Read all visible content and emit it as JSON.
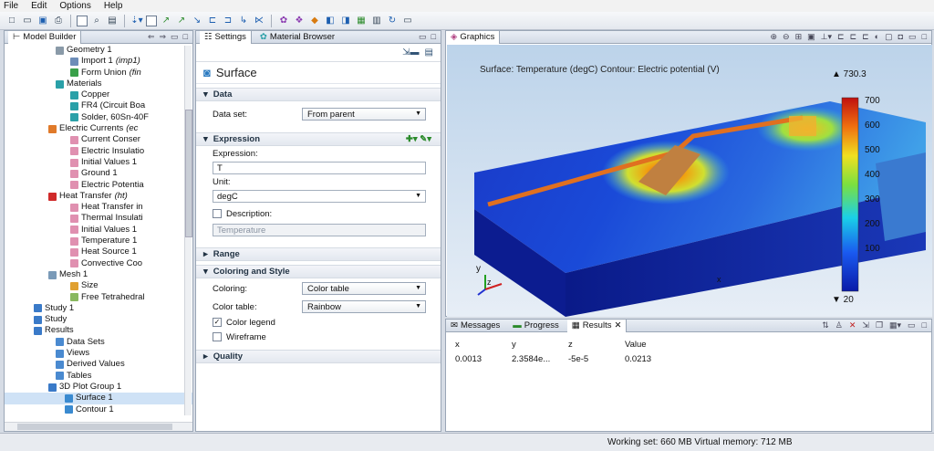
{
  "menu": [
    "File",
    "Edit",
    "Options",
    "Help"
  ],
  "builder": {
    "title": "Model Builder",
    "tree": [
      {
        "label": "Geometry 1",
        "indent": 70,
        "color": "#8a9aa8"
      },
      {
        "label": "Import 1",
        "suffix": " (imp1)",
        "indent": 86,
        "color": "#6d8db8"
      },
      {
        "label": "Form Union",
        "suffix": " (fin",
        "indent": 86,
        "color": "#39a04a"
      },
      {
        "label": "Materials",
        "indent": 70,
        "color": "#2aa0a8"
      },
      {
        "label": "Copper",
        "indent": 86,
        "color": "#2aa0a8"
      },
      {
        "label": "FR4 (Circuit Boa",
        "indent": 86,
        "color": "#2aa0a8"
      },
      {
        "label": "Solder, 60Sn-40F",
        "indent": 86,
        "color": "#2aa0a8"
      },
      {
        "label": "Electric Currents",
        "suffix": " (ec",
        "indent": 62,
        "color": "#e07a2a"
      },
      {
        "label": "Current Conser",
        "indent": 86,
        "color": "#e090b0"
      },
      {
        "label": "Electric Insulatio",
        "indent": 86,
        "color": "#e090b0"
      },
      {
        "label": "Initial Values 1",
        "indent": 86,
        "color": "#e090b0"
      },
      {
        "label": "Ground 1",
        "indent": 86,
        "color": "#e090b0"
      },
      {
        "label": "Electric Potentia",
        "indent": 86,
        "color": "#e090b0"
      },
      {
        "label": "Heat Transfer",
        "suffix": " (ht)",
        "indent": 62,
        "color": "#d02a2a"
      },
      {
        "label": "Heat Transfer in",
        "indent": 86,
        "color": "#e090b0"
      },
      {
        "label": "Thermal Insulati",
        "indent": 86,
        "color": "#e090b0"
      },
      {
        "label": "Initial Values 1",
        "indent": 86,
        "color": "#e090b0"
      },
      {
        "label": "Temperature 1",
        "indent": 86,
        "color": "#e090b0"
      },
      {
        "label": "Heat Source 1",
        "indent": 86,
        "color": "#e090b0"
      },
      {
        "label": "Convective Coo",
        "indent": 86,
        "color": "#e090b0"
      },
      {
        "label": "Mesh 1",
        "indent": 62,
        "color": "#7a9ab8"
      },
      {
        "label": "Size",
        "indent": 86,
        "color": "#e0a030"
      },
      {
        "label": "Free Tetrahedral",
        "indent": 86,
        "color": "#8ab860"
      },
      {
        "label": "Study 1",
        "indent": 46,
        "color": "#3a7ac8"
      },
      {
        "label": "Study",
        "indent": 46,
        "color": "#3a7ac8"
      },
      {
        "label": "Results",
        "indent": 46,
        "color": "#3a7ac8"
      },
      {
        "label": "Data Sets",
        "indent": 70,
        "color": "#4a8ad0"
      },
      {
        "label": "Views",
        "indent": 70,
        "color": "#4a8ad0"
      },
      {
        "label": "Derived Values",
        "indent": 70,
        "color": "#4a8ad0"
      },
      {
        "label": "Tables",
        "indent": 70,
        "color": "#4a8ad0"
      },
      {
        "label": "3D Plot Group 1",
        "indent": 62,
        "color": "#3a7ac8"
      },
      {
        "label": "Surface 1",
        "indent": 80,
        "color": "#3a8ad0",
        "selected": true
      },
      {
        "label": "Contour 1",
        "indent": 80,
        "color": "#3a8ad0"
      }
    ]
  },
  "settings": {
    "tab_settings": "Settings",
    "tab_material": "Material Browser",
    "heading": "Surface",
    "sec_data": "Data",
    "dataset_label": "Data set:",
    "dataset_value": "From parent",
    "sec_expression": "Expression",
    "expression_label": "Expression:",
    "expression_value": "T",
    "unit_label": "Unit:",
    "unit_value": "degC",
    "description_label": "Description:",
    "description_value": "Temperature",
    "sec_range": "Range",
    "sec_coloring": "Coloring and Style",
    "coloring_label": "Coloring:",
    "coloring_value": "Color table",
    "colortable_label": "Color table:",
    "colortable_value": "Rainbow",
    "colorlegend_label": "Color legend",
    "colorlegend_checked": true,
    "wireframe_label": "Wireframe",
    "wireframe_checked": false,
    "sec_quality": "Quality"
  },
  "graphics": {
    "tab": "Graphics",
    "title": "Surface: Temperature (degC) Contour: Electric potential (V)",
    "max_label": "▲ 730.3",
    "min_label": "▼ 20",
    "ticks": [
      "700",
      "600",
      "500",
      "400",
      "300",
      "200",
      "100"
    ],
    "axis_y": "y",
    "axis_z": "z",
    "axis_x": "x"
  },
  "results_panel": {
    "tab_messages": "Messages",
    "tab_progress": "Progress",
    "tab_results": "Results",
    "columns": [
      "x",
      "y",
      "z",
      "Value"
    ],
    "rows": [
      [
        "0.0013",
        "2.3584e...",
        "-5e-5",
        "0.0213"
      ]
    ]
  },
  "status": "Working set: 660 MB  Virtual memory: 712 MB"
}
